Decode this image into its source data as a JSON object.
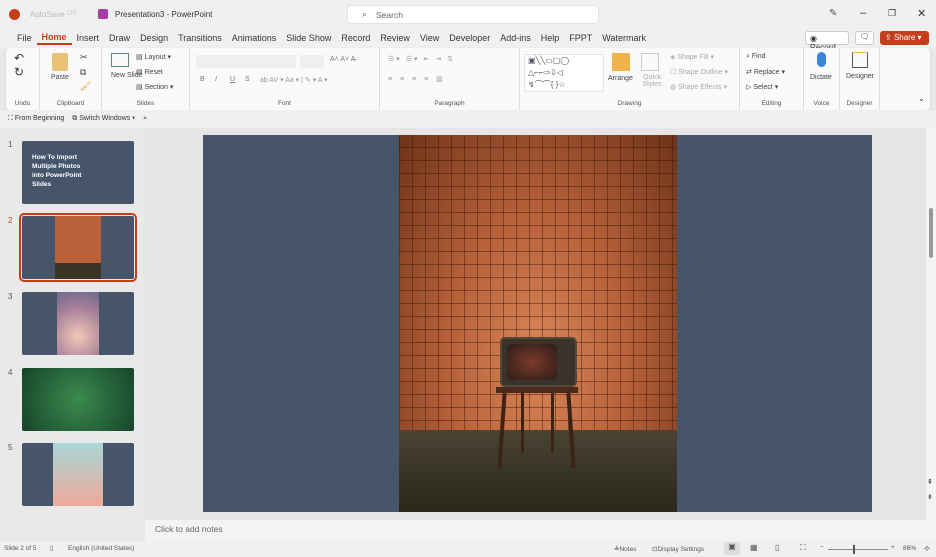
{
  "titlebar": {
    "autosave": "AutoSave",
    "autosave_state": "Off",
    "title": "Presentation3 - PowerPoint",
    "search_placeholder": "Search"
  },
  "tabs": [
    "File",
    "Home",
    "Insert",
    "Draw",
    "Design",
    "Transitions",
    "Animations",
    "Slide Show",
    "Record",
    "Review",
    "View",
    "Developer",
    "Add-ins",
    "Help",
    "FPPT",
    "Watermark"
  ],
  "active_tab": "Home",
  "actions": {
    "record": "Record",
    "share": "Share"
  },
  "ribbon": {
    "undo": {
      "label": "Undo"
    },
    "clipboard": {
      "paste": "Paste",
      "label": "Clipboard"
    },
    "slides": {
      "new_slide": "New Slide",
      "layout": "Layout",
      "reset": "Reset",
      "section": "Section",
      "label": "Slides"
    },
    "font": {
      "label": "Font",
      "bold": "B",
      "italic": "I",
      "underline": "U",
      "strike": "S"
    },
    "paragraph": {
      "label": "Paragraph"
    },
    "drawing": {
      "arrange": "Arrange",
      "quick_styles": "Quick Styles",
      "shape_fill": "Shape Fill",
      "shape_outline": "Shape Outline",
      "shape_effects": "Shape Effects",
      "label": "Drawing"
    },
    "editing": {
      "find": "Find",
      "replace": "Replace",
      "select": "Select",
      "label": "Editing"
    },
    "voice": {
      "dictate": "Dictate",
      "label": "Voice"
    },
    "designer": {
      "designer": "Designer",
      "label": "Designer"
    }
  },
  "qat": {
    "from_beginning": "From Beginning",
    "switch_windows": "Switch Windows"
  },
  "slides": [
    {
      "number": "1",
      "title": "How To Import Multiple Photos into PowerPoint Slides"
    },
    {
      "number": "2",
      "selected": true
    },
    {
      "number": "3"
    },
    {
      "number": "4"
    },
    {
      "number": "5"
    }
  ],
  "notes_placeholder": "Click to add notes",
  "status": {
    "slide": "Slide 2 of 5",
    "language": "English (United States)",
    "notes": "Notes",
    "display_settings": "Display Settings",
    "zoom": "86%"
  },
  "colors": {
    "accent": "#c43e1c",
    "slide_bg": "#47556a"
  }
}
